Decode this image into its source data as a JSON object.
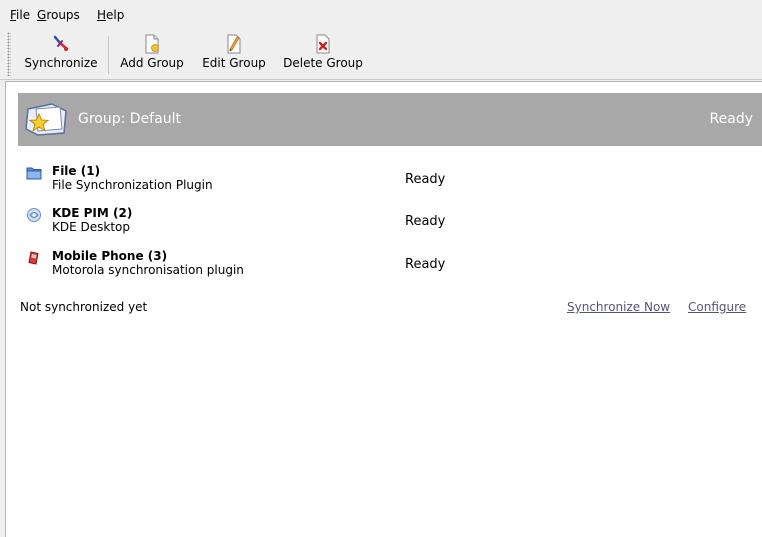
{
  "menubar": {
    "file_label": "File",
    "file_accel": "F",
    "file_rest": "ile",
    "groups_accel": "G",
    "groups_rest": "roups",
    "help_accel": "H",
    "help_rest": "elp"
  },
  "toolbar": {
    "synchronize_label": "Synchronize",
    "add_group_label": "Add Group",
    "edit_group_label": "Edit Group",
    "delete_group_label": "Delete Group"
  },
  "group": {
    "title": "Group: Default",
    "status": "Ready"
  },
  "members": [
    {
      "name": "File (1)",
      "description": "File Synchronization Plugin",
      "status": "Ready",
      "icon": "folder-icon"
    },
    {
      "name": "KDE PIM (2)",
      "description": "KDE Desktop",
      "status": "Ready",
      "icon": "kde-pim-icon"
    },
    {
      "name": "Mobile Phone (3)",
      "description": "Motorola synchronisation plugin",
      "status": "Ready",
      "icon": "mobile-phone-icon"
    }
  ],
  "footer": {
    "sync_state": "Not synchronized yet",
    "synchronize_now_link": "Synchronize Now",
    "configure_link": "Configure"
  },
  "colors": {
    "header_bg": "#a8a8a8",
    "window_bg": "#efefef",
    "link": "#555577"
  }
}
